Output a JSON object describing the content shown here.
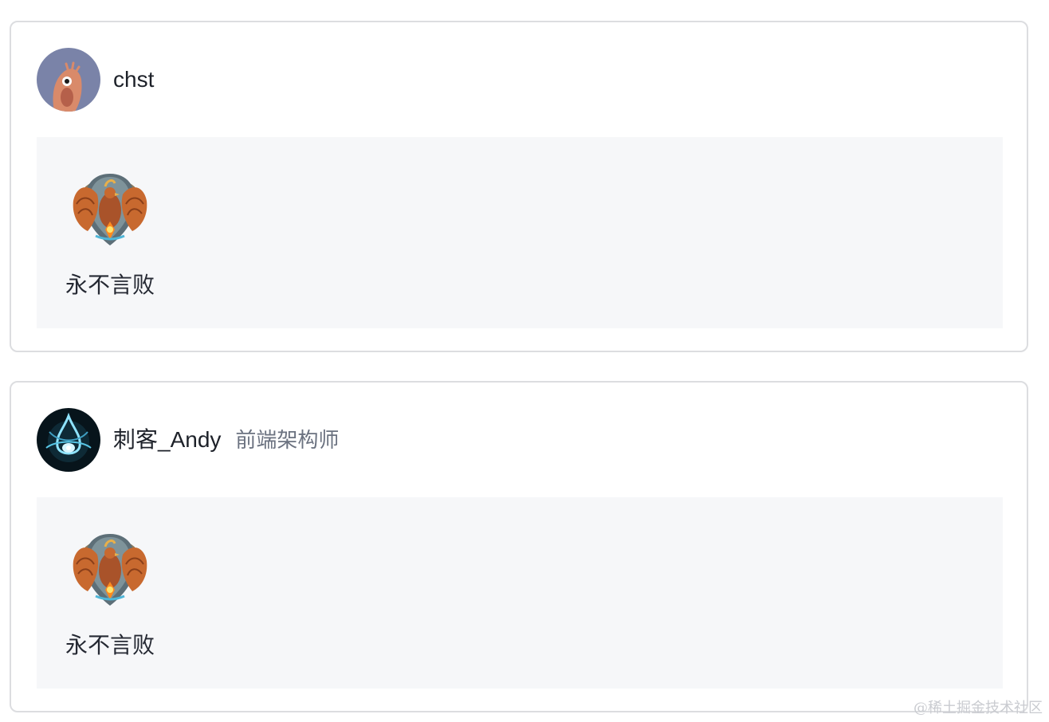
{
  "cards": [
    {
      "user": {
        "name": "chst",
        "title": ""
      },
      "badge": {
        "name": "永不言败"
      }
    },
    {
      "user": {
        "name": "刺客_Andy",
        "title": "前端架构师"
      },
      "badge": {
        "name": "永不言败"
      }
    }
  ],
  "watermark": "@稀土掘金技术社区",
  "colors": {
    "card_border": "#dcdde0",
    "panel_bg": "#f6f7f9",
    "username": "#1d2129",
    "title_text": "#6b7280",
    "avatar1_bg": "#7a83a8",
    "avatar1_figure": "#d98a6a"
  },
  "icons": {
    "avatar1": "cartoon-creature-avatar",
    "avatar2": "blue-energy-orb-avatar",
    "badge": "phoenix-crest-badge"
  }
}
